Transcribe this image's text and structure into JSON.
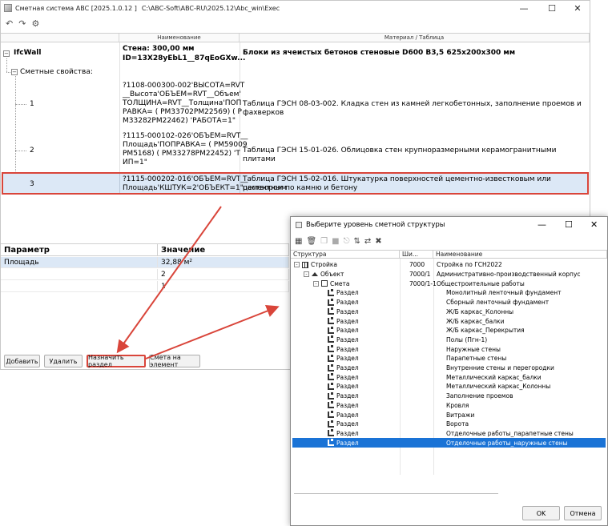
{
  "main": {
    "title": "Сметная система ABC [2025.1.0.12 ]",
    "path": "C:\\ABC-Soft\\ABC-RU\\2025.12\\Abc_win\\Exec",
    "columns": {
      "name": "Наименование",
      "material": "Материал / Таблица"
    },
    "ifc": {
      "label": "IfcWall",
      "name_line1": "Стена: 300,00 мм",
      "name_line2": "ID=13X28yEbL1__87qEoGXw...",
      "material": "Блоки из ячеистых бетонов стеновые D600 В3,5 625х200х300 мм"
    },
    "group_label": "Сметные свойства:",
    "rows": [
      {
        "num": "1",
        "formula": [
          "?1108-000300-002'ВЫСОТА=RVT",
          "__Высота'ОБЪЕМ=RVT__Объем'",
          "ТОЛЩИНА=RVT__Толщина'ПОП",
          "РАВКА= ( PM33702PM22569)    ( P",
          "M33282PM22462)  'РАБОТА=1\""
        ],
        "table": "Таблица ГЭСН 08-03-002. Кладка стен из камней легкобетонных, заполнение проемов и фахверков"
      },
      {
        "num": "2",
        "formula": [
          "?1115-000102-026'ОБЪЕМ=RVT__",
          "Площадь'ПОПРАВКА= ( PM59009",
          "PM5168)    ( PM33278PM22452)  'Т",
          "ИП=1\""
        ],
        "table": "Таблица ГЭСН 15-01-026. Облицовка стен крупноразмерными керамогранитными плитами"
      },
      {
        "num": "3",
        "formula": [
          "?1115-000202-016'ОБЪЕМ=RVT__",
          "Площадь'КШТУК=2'ОБЪЕКТ=1\""
        ],
        "table": [
          "Таблица ГЭСН 15-02-016. Штукатурка поверхностей цементно-известковым или цементным",
          "раствором по камню и бетону"
        ]
      }
    ],
    "params": {
      "header_param": "Параметр",
      "header_value": "Значение",
      "rows": [
        {
          "param": "Площадь",
          "value": "32,88  м²"
        },
        {
          "param": "",
          "value": "2"
        },
        {
          "param": "",
          "value": "1"
        }
      ]
    },
    "buttons": {
      "add": "Добавить",
      "delete": "Удалить",
      "assign": "Назначить раздел",
      "estimate": "Смета на элемент"
    }
  },
  "dialog": {
    "title": "Выберите уровень сметной структуры",
    "columns": {
      "structure": "Структура",
      "code": "Ши...",
      "name": "Наименование"
    },
    "rows": [
      {
        "type": "Стройка",
        "code": "7000",
        "name": "Стройка по ГСН2022",
        "level": 0
      },
      {
        "type": "Объект",
        "code": "7000/1",
        "name": "Административно-производственный корпус",
        "level": 1
      },
      {
        "type": "Смета",
        "code": "7000/1-1",
        "name": "Общестроительные работы",
        "level": 2
      },
      {
        "type": "Раздел",
        "code": "",
        "name": "Монолитный ленточный фундамент",
        "level": 3
      },
      {
        "type": "Раздел",
        "code": "",
        "name": "Сборный ленточный фундамент",
        "level": 3
      },
      {
        "type": "Раздел",
        "code": "",
        "name": "Ж/Б каркас_Колонны",
        "level": 3
      },
      {
        "type": "Раздел",
        "code": "",
        "name": "Ж/Б каркас_балки",
        "level": 3
      },
      {
        "type": "Раздел",
        "code": "",
        "name": "Ж/Б каркас_Перекрытия",
        "level": 3
      },
      {
        "type": "Раздел",
        "code": "",
        "name": "Полы (Пгн-1)",
        "level": 3
      },
      {
        "type": "Раздел",
        "code": "",
        "name": "Наружные стены",
        "level": 3
      },
      {
        "type": "Раздел",
        "code": "",
        "name": "Парапетные стены",
        "level": 3
      },
      {
        "type": "Раздел",
        "code": "",
        "name": "Внутренние стены и перегородки",
        "level": 3
      },
      {
        "type": "Раздел",
        "code": "",
        "name": "Металлический каркас_балки",
        "level": 3
      },
      {
        "type": "Раздел",
        "code": "",
        "name": "Металлический каркас_Колонны",
        "level": 3
      },
      {
        "type": "Раздел",
        "code": "",
        "name": "Заполнение проемов",
        "level": 3
      },
      {
        "type": "Раздел",
        "code": "",
        "name": "Кровля",
        "level": 3
      },
      {
        "type": "Раздел",
        "code": "",
        "name": "Витражи",
        "level": 3
      },
      {
        "type": "Раздел",
        "code": "",
        "name": "Ворота",
        "level": 3
      },
      {
        "type": "Раздел",
        "code": "",
        "name": "Отделочные работы_парапетные стены",
        "level": 3
      },
      {
        "type": "Раздел",
        "code": "",
        "name": "Отделочные работы_наружные стены",
        "level": 3,
        "selected": true
      }
    ],
    "ok": "OK",
    "cancel": "Отмена"
  },
  "colors": {
    "selection": "#1a73d6",
    "highlight": "#dce8f6",
    "annotation": "#d9453a"
  }
}
